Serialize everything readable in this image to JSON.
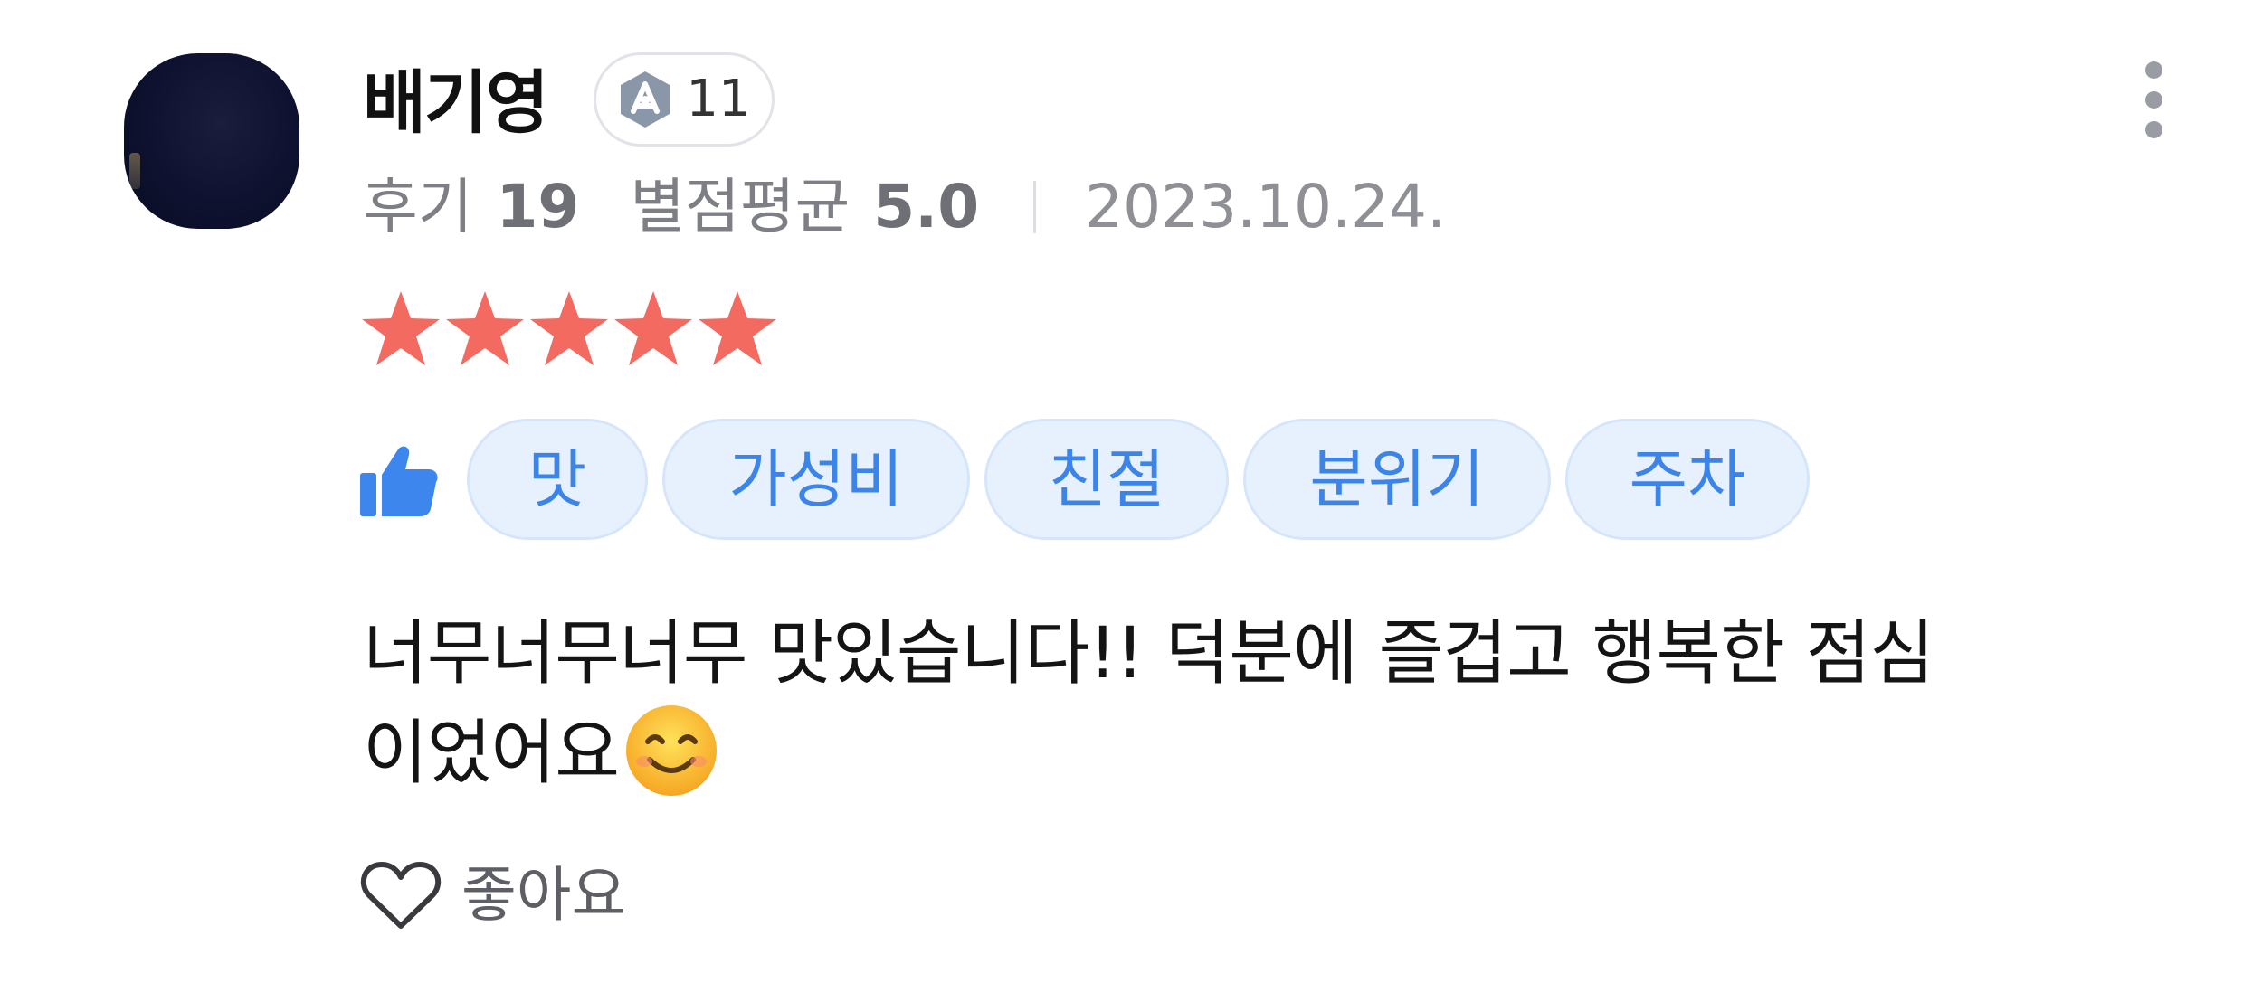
{
  "review": {
    "user": {
      "name": "배기영",
      "level": "11"
    },
    "meta": {
      "review_label": "후기",
      "review_count": "19",
      "rating_label": "별점평균",
      "rating_avg": "5.0",
      "date": "2023.10.24."
    },
    "rating": {
      "stars": 5,
      "max": 5,
      "color": "#f26a60"
    },
    "tags": [
      "맛",
      "가성비",
      "친절",
      "분위기",
      "주차"
    ],
    "tag_colors": {
      "bg": "#e7f1fd",
      "text": "#3c84e8"
    },
    "text_line1": "너무너무너무 맛있습니다!! 덕분에 즐겁고 행복한 점심",
    "text_line2": "이었어요",
    "like_label": "좋아요"
  }
}
